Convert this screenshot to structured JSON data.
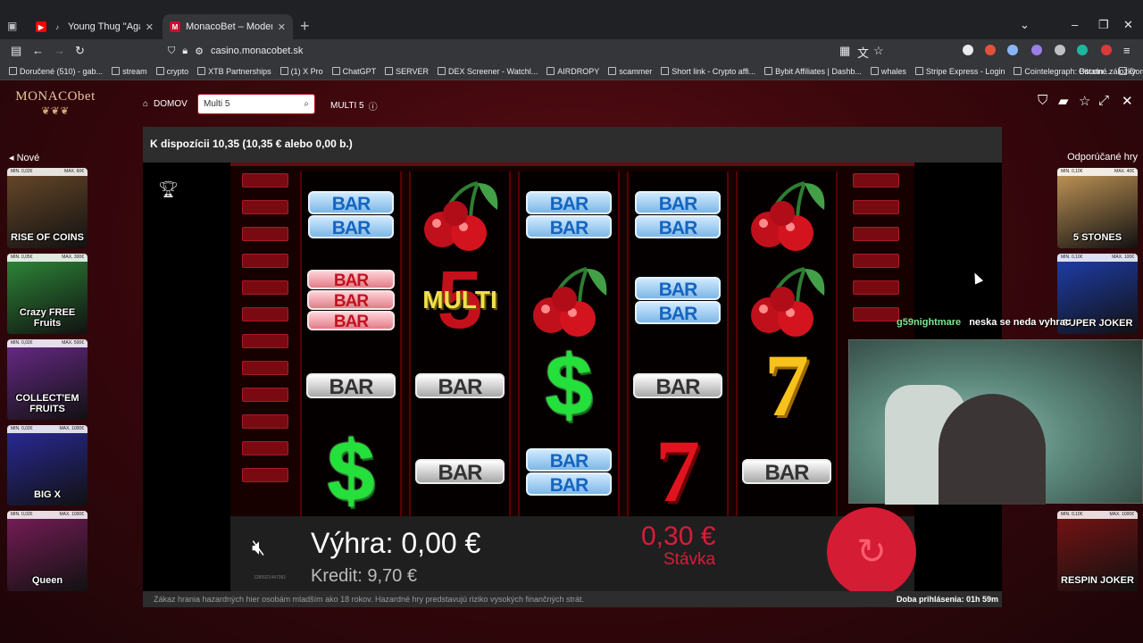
{
  "browser": {
    "tabs": [
      {
        "title": "Young Thug \"Again\" feat G",
        "favicon": "youtube-icon",
        "color": "#ff0000"
      },
      {
        "title": "MonacoBet – Moderné Online",
        "favicon": "M",
        "color": "#c8102e"
      }
    ],
    "url": "casino.monacobet.sk",
    "bookmarks": [
      "Doručené (510) - gab...",
      "stream",
      "crypto",
      "XTB Partnerships",
      "(1) X Pro",
      "ChatGPT",
      "SERVER",
      "DEX Screener - Watchl...",
      "AIRDROPY",
      "scammer",
      "Short link - Crypto affi...",
      "Bybit Affiliates | Dashb...",
      "whales",
      "Stripe Express - Login",
      "Cointelegraph: Bitcoin...",
      "Domov"
    ],
    "other_bookmarks": "Ostatné záložky"
  },
  "site": {
    "logo": "MONACObet",
    "nav_home": "DOMOV",
    "search_value": "Multi 5",
    "game_title": "MULTI 5",
    "sidebar_left_title": "Nové",
    "sidebar_right_title": "Odporúčané hry",
    "left_games": [
      {
        "name": "RISE OF COINS",
        "min": "MIN. 0,02€",
        "max": "MAX. 60€",
        "bg": "#6b4a2a"
      },
      {
        "name": "Crazy FREE Fruits",
        "min": "MIN. 0,05€",
        "max": "MAX. 300€",
        "bg": "#2f8c3a"
      },
      {
        "name": "COLLECT'EM FRUITS",
        "min": "MIN. 0,02€",
        "max": "MAX. 500€",
        "bg": "#6a2a8a"
      },
      {
        "name": "BIG X",
        "min": "MIN. 0,02€",
        "max": "MAX. 1000€",
        "bg": "#2a2a9c"
      },
      {
        "name": "Queen",
        "min": "MIN. 0,02€",
        "max": "MAX. 1000€",
        "bg": "#7a1d5a"
      }
    ],
    "right_games": [
      {
        "name": "5 STONES",
        "min": "MIN. 0,10€",
        "max": "MAX. 40€",
        "bg": "#c79a5a"
      },
      {
        "name": "SUPER JOKER",
        "min": "MIN. 0,10€",
        "max": "MAX. 100€",
        "bg": "#1f3fb0"
      },
      {
        "name": "RESPIN JOKER",
        "min": "MIN. 0,10€",
        "max": "MAX. 1000€",
        "bg": "#7a1212"
      }
    ],
    "balance_text": "K dispozícii 10,35 (10,35 € alebo 0,00 b.)",
    "footer_warning": "Zákaz hrania hazardných hier osobám mladším ako 18 rokov. Hazardné hry predstavujú riziko vysokých finančných strát.",
    "session_time": "Doba prihlásenia: 01h 59m"
  },
  "slot": {
    "reels": [
      [
        "bar-blue-2",
        "bar-red-3",
        "bar-silver",
        "dollar"
      ],
      [
        "cherry",
        "multi5",
        "bar-silver",
        "bar-silver"
      ],
      [
        "bar-blue-2",
        "cherry",
        "dollar",
        "bar-blue-2"
      ],
      [
        "bar-blue-2",
        "bar-blue-2",
        "bar-silver",
        "seven-red"
      ],
      [
        "cherry",
        "cherry",
        "seven-gold",
        "bar-silver"
      ]
    ],
    "bar_label": "BAR",
    "dollar_label": "$",
    "seven_label": "7",
    "multi_five": "5",
    "multi_label": "MULTI",
    "win_label": "Výhra:",
    "win_value": "0,00 €",
    "credit_label": "Kredit:",
    "credit_value": "9,70 €",
    "bet_value": "0,30 €",
    "bet_label": "Stávka",
    "session_id": "1285921447381"
  },
  "stream": {
    "chat_user": "g59nightmare",
    "chat_message": "neska se neda vyhrac"
  }
}
